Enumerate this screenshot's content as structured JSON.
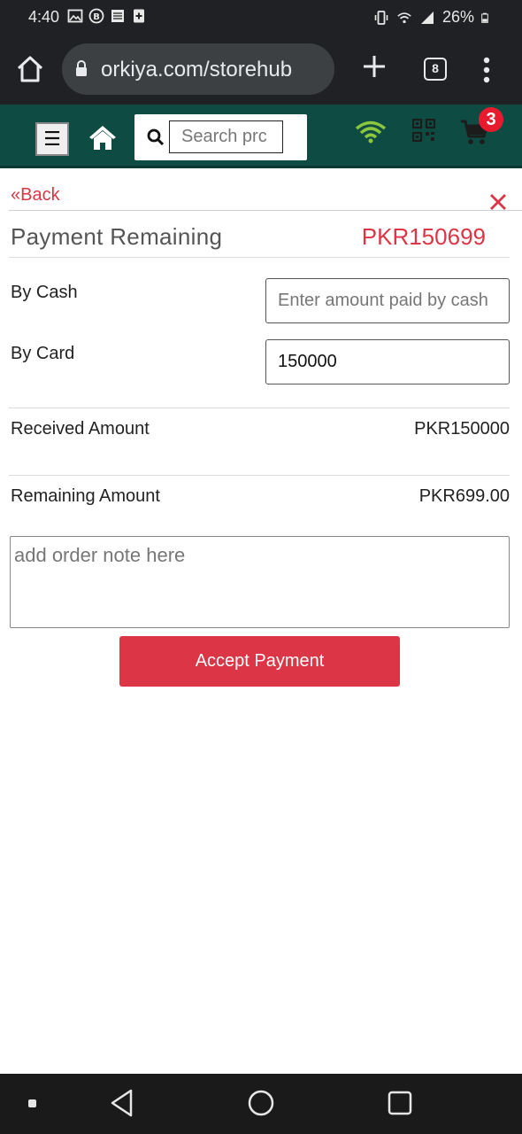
{
  "status_bar": {
    "time": "4:40",
    "battery": "26%",
    "icons": [
      "image-icon",
      "b-circle-icon",
      "app-icon",
      "plus-box-icon",
      "vibrate-icon",
      "wifi-icon",
      "signal-icon",
      "battery-icon"
    ]
  },
  "browser": {
    "url": "orkiya.com/storehub",
    "tab_count": "8",
    "icons": [
      "home-icon",
      "lock-icon",
      "plus-icon",
      "menu-dots-icon"
    ]
  },
  "header": {
    "menu_glyph": "☰",
    "search_placeholder": "Search prc",
    "cart_count": "3",
    "colors": {
      "header_bg": "#0e4b43",
      "wifi": "#8dc63f",
      "badge": "#e81b2e"
    }
  },
  "nav": {
    "back_label": "«Back"
  },
  "payment": {
    "title": "Payment Remaining",
    "remaining_total": "PKR150699",
    "cash_label": "By Cash",
    "cash_placeholder": "Enter amount paid by cash",
    "cash_value": "",
    "card_label": "By Card",
    "card_value": "150000",
    "received_label": "Received Amount",
    "received_value": "PKR150000",
    "remaining_label": "Remaining Amount",
    "remaining_value": "PKR699.00",
    "note_placeholder": "add order note here",
    "accept_label": "Accept Payment",
    "colors": {
      "accent": "#dc3545"
    }
  }
}
